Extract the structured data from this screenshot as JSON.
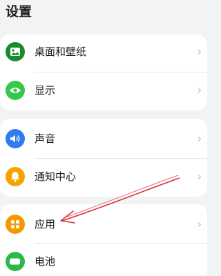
{
  "header": {
    "title": "设置"
  },
  "groups": [
    {
      "items": [
        {
          "label": "桌面和壁纸",
          "icon": "wallpaper-icon",
          "color": "#1b8a2e",
          "chevron": "›"
        },
        {
          "label": "显示",
          "icon": "eye-icon",
          "color": "#36c84a",
          "chevron": "›"
        }
      ]
    },
    {
      "items": [
        {
          "label": "声音",
          "icon": "speaker-icon",
          "color": "#2f7bf0",
          "chevron": "›"
        },
        {
          "label": "通知中心",
          "icon": "bell-icon",
          "color": "#f5a300",
          "chevron": "›"
        }
      ]
    },
    {
      "items": [
        {
          "label": "应用",
          "icon": "apps-grid-icon",
          "color": "#f39a00",
          "chevron": "›"
        },
        {
          "label": "电池",
          "icon": "battery-icon",
          "color": "#2fb84a",
          "chevron": ""
        }
      ]
    }
  ],
  "annotation": {
    "type": "arrow",
    "color": "#d9313a",
    "points_to": "应用"
  }
}
